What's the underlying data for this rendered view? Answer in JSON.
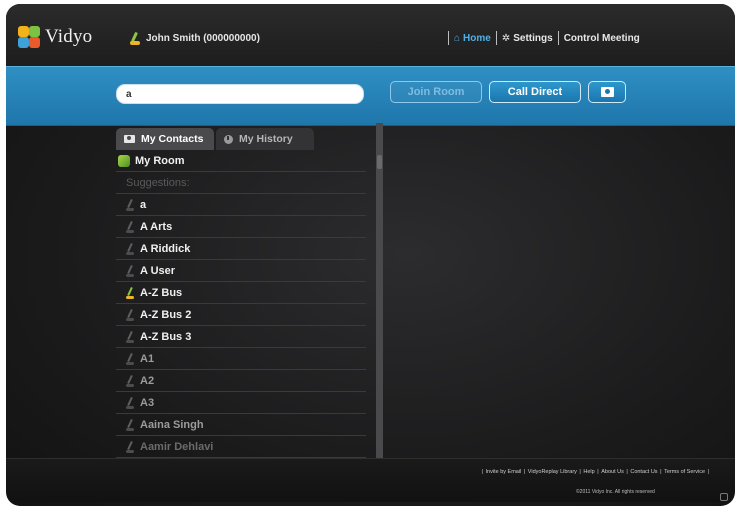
{
  "brand": {
    "name": "Vidyo"
  },
  "header": {
    "user": "John Smith (000000000)",
    "nav": [
      {
        "label": "Home",
        "icon": "home-icon",
        "active": true
      },
      {
        "label": "Settings",
        "icon": "gear-icon",
        "active": false
      },
      {
        "label": "Control Meeting",
        "icon": "",
        "active": false
      }
    ]
  },
  "search": {
    "value": "a"
  },
  "actions": {
    "join_label": "Join Room",
    "call_label": "Call Direct"
  },
  "tabs": {
    "contacts": "My Contacts",
    "history": "My History"
  },
  "list": {
    "my_room": "My Room",
    "suggestions_label": "Suggestions:",
    "items": [
      {
        "label": "a",
        "online": false
      },
      {
        "label": "A Arts",
        "online": false
      },
      {
        "label": "A Riddick",
        "online": false
      },
      {
        "label": "A User",
        "online": false
      },
      {
        "label": "A-Z Bus",
        "online": true
      },
      {
        "label": "A-Z Bus 2",
        "online": false
      },
      {
        "label": "A-Z Bus 3",
        "online": false
      },
      {
        "label": "A1",
        "online": false
      },
      {
        "label": "A2",
        "online": false
      },
      {
        "label": "A3",
        "online": false
      },
      {
        "label": "Aaina Singh",
        "online": false
      },
      {
        "label": "Aamir Dehlavi",
        "online": false
      }
    ]
  },
  "footer": {
    "links": [
      "Invite by Email",
      "VidyoReplay Library",
      "Help",
      "About Us",
      "Contact Us",
      "Terms of Service"
    ],
    "copyright": "©2011 Vidyo Inc. All rights reserved"
  },
  "colors": {
    "accent": "#2f8fc3",
    "nav_active": "#4fb0e6"
  }
}
